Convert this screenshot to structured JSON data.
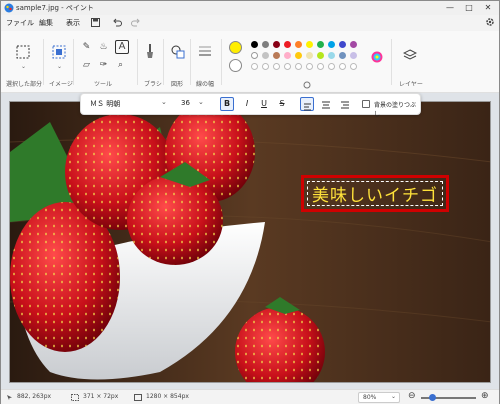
{
  "window": {
    "title": "sample7.jpg - ペイント"
  },
  "menu": {
    "items": [
      "ファイル",
      "編集",
      "表示"
    ]
  },
  "ribbon": {
    "groups": {
      "select": "選択した部分",
      "image": "イメージ",
      "tools": "ツール",
      "brushes": "ブラシ",
      "shapes": "図形",
      "size": "線の幅",
      "layers": "レイヤー"
    },
    "colors": {
      "primary": "#ffee00",
      "secondary": "#ffffff",
      "palette_row1": [
        "#000000",
        "#7f7f7f",
        "#880015",
        "#ed1c24",
        "#ff7f27",
        "#fff200",
        "#22b14c",
        "#00a2e8",
        "#3f48cc",
        "#a349a4"
      ],
      "palette_row2": [
        "#ffffff",
        "#c3c3c3",
        "#b97a57",
        "#ffaec9",
        "#ffc90e",
        "#efe4b0",
        "#b5e61d",
        "#99d9ea",
        "#7092be",
        "#c8bfe7"
      ]
    }
  },
  "textbar": {
    "font": "ＭＳ 明朝",
    "size": "36",
    "bold": "B",
    "italic": "I",
    "underline": "U",
    "strike": "S",
    "bg_fill_label": "背景の塗りつぶし"
  },
  "canvas": {
    "text": "美味しいイチゴ",
    "text_color": "#ffe23a",
    "box_color": "#d00000"
  },
  "status": {
    "cursor": "882, 263px",
    "selection": "371 × 72px",
    "image_size": "1280 × 854px",
    "zoom": "80%"
  }
}
